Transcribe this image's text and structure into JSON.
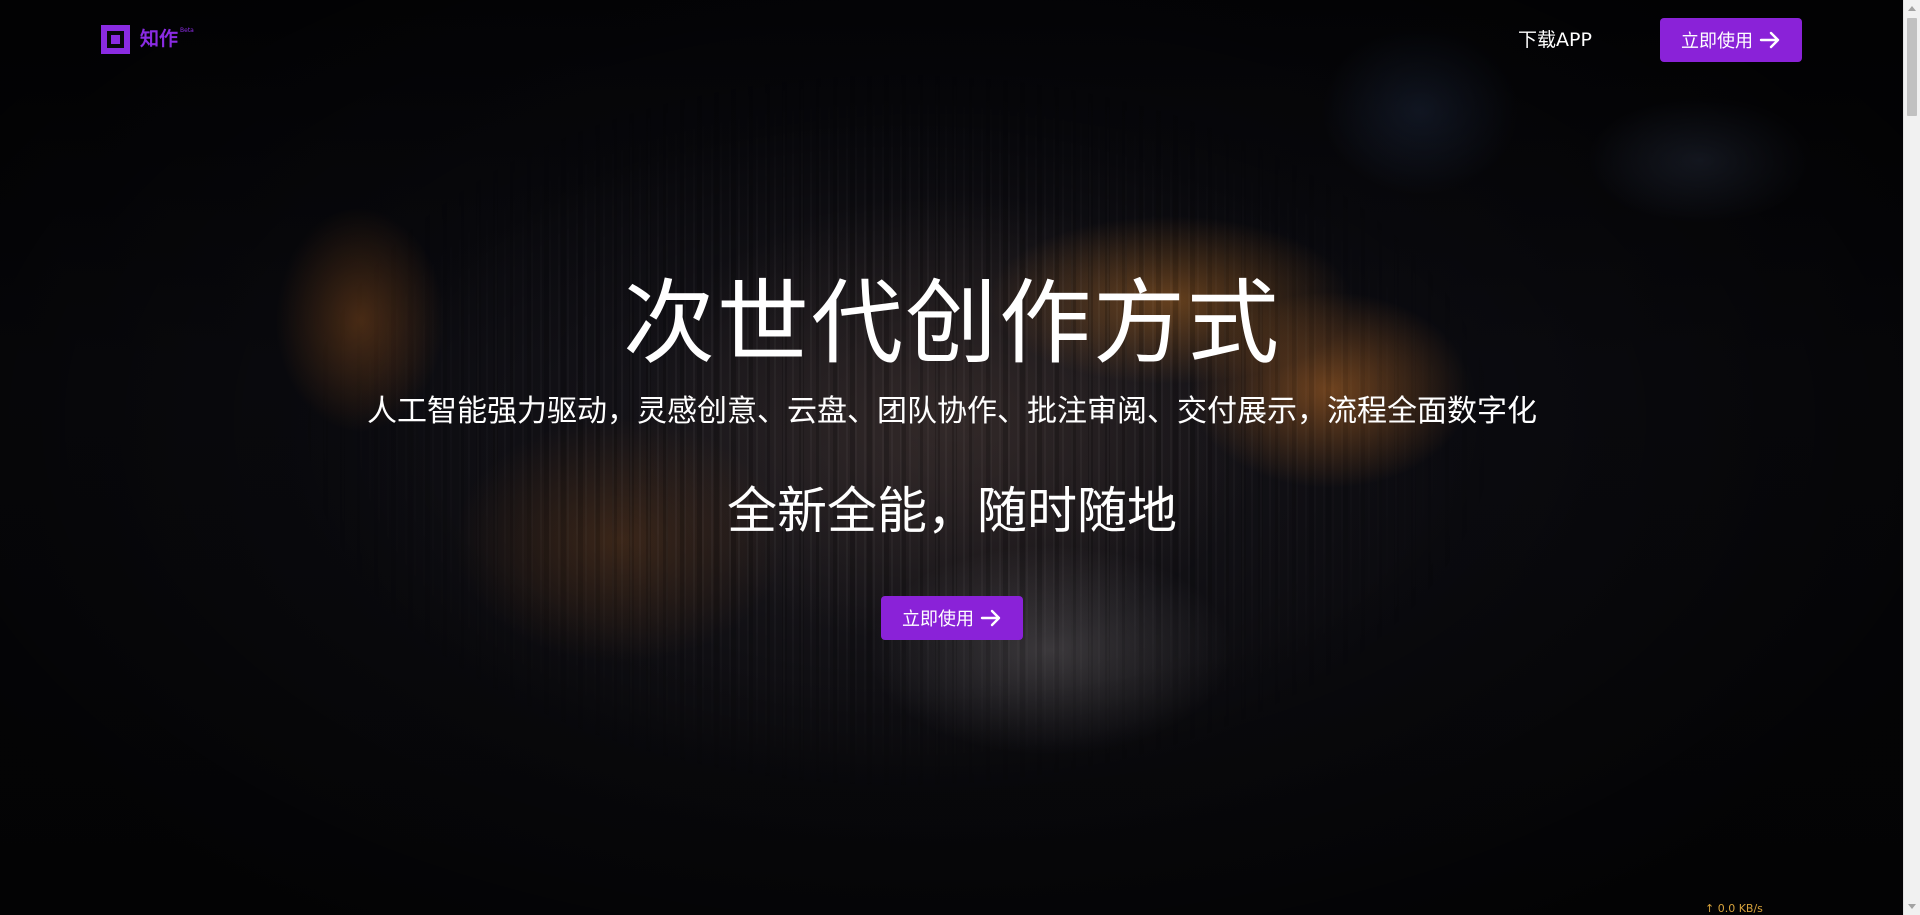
{
  "header": {
    "logo_text": "知作",
    "logo_badge": "Beta",
    "download_label": "下载APP",
    "cta_label": "立即使用"
  },
  "hero": {
    "title": "次世代创作方式",
    "subtitle": "人工智能强力驱动，灵感创意、云盘、团队协作、批注审阅、交付展示，流程全面数字化",
    "tagline": "全新全能，随时随地",
    "cta_label": "立即使用"
  },
  "overlay": {
    "net_speed": "↑ 0.0 KB/s"
  },
  "theme": {
    "accent": "#8a22d8",
    "background": "#07070a"
  },
  "icons": {
    "logo": "square-logo-icon",
    "cta_arrow": "arrow-right-icon"
  }
}
